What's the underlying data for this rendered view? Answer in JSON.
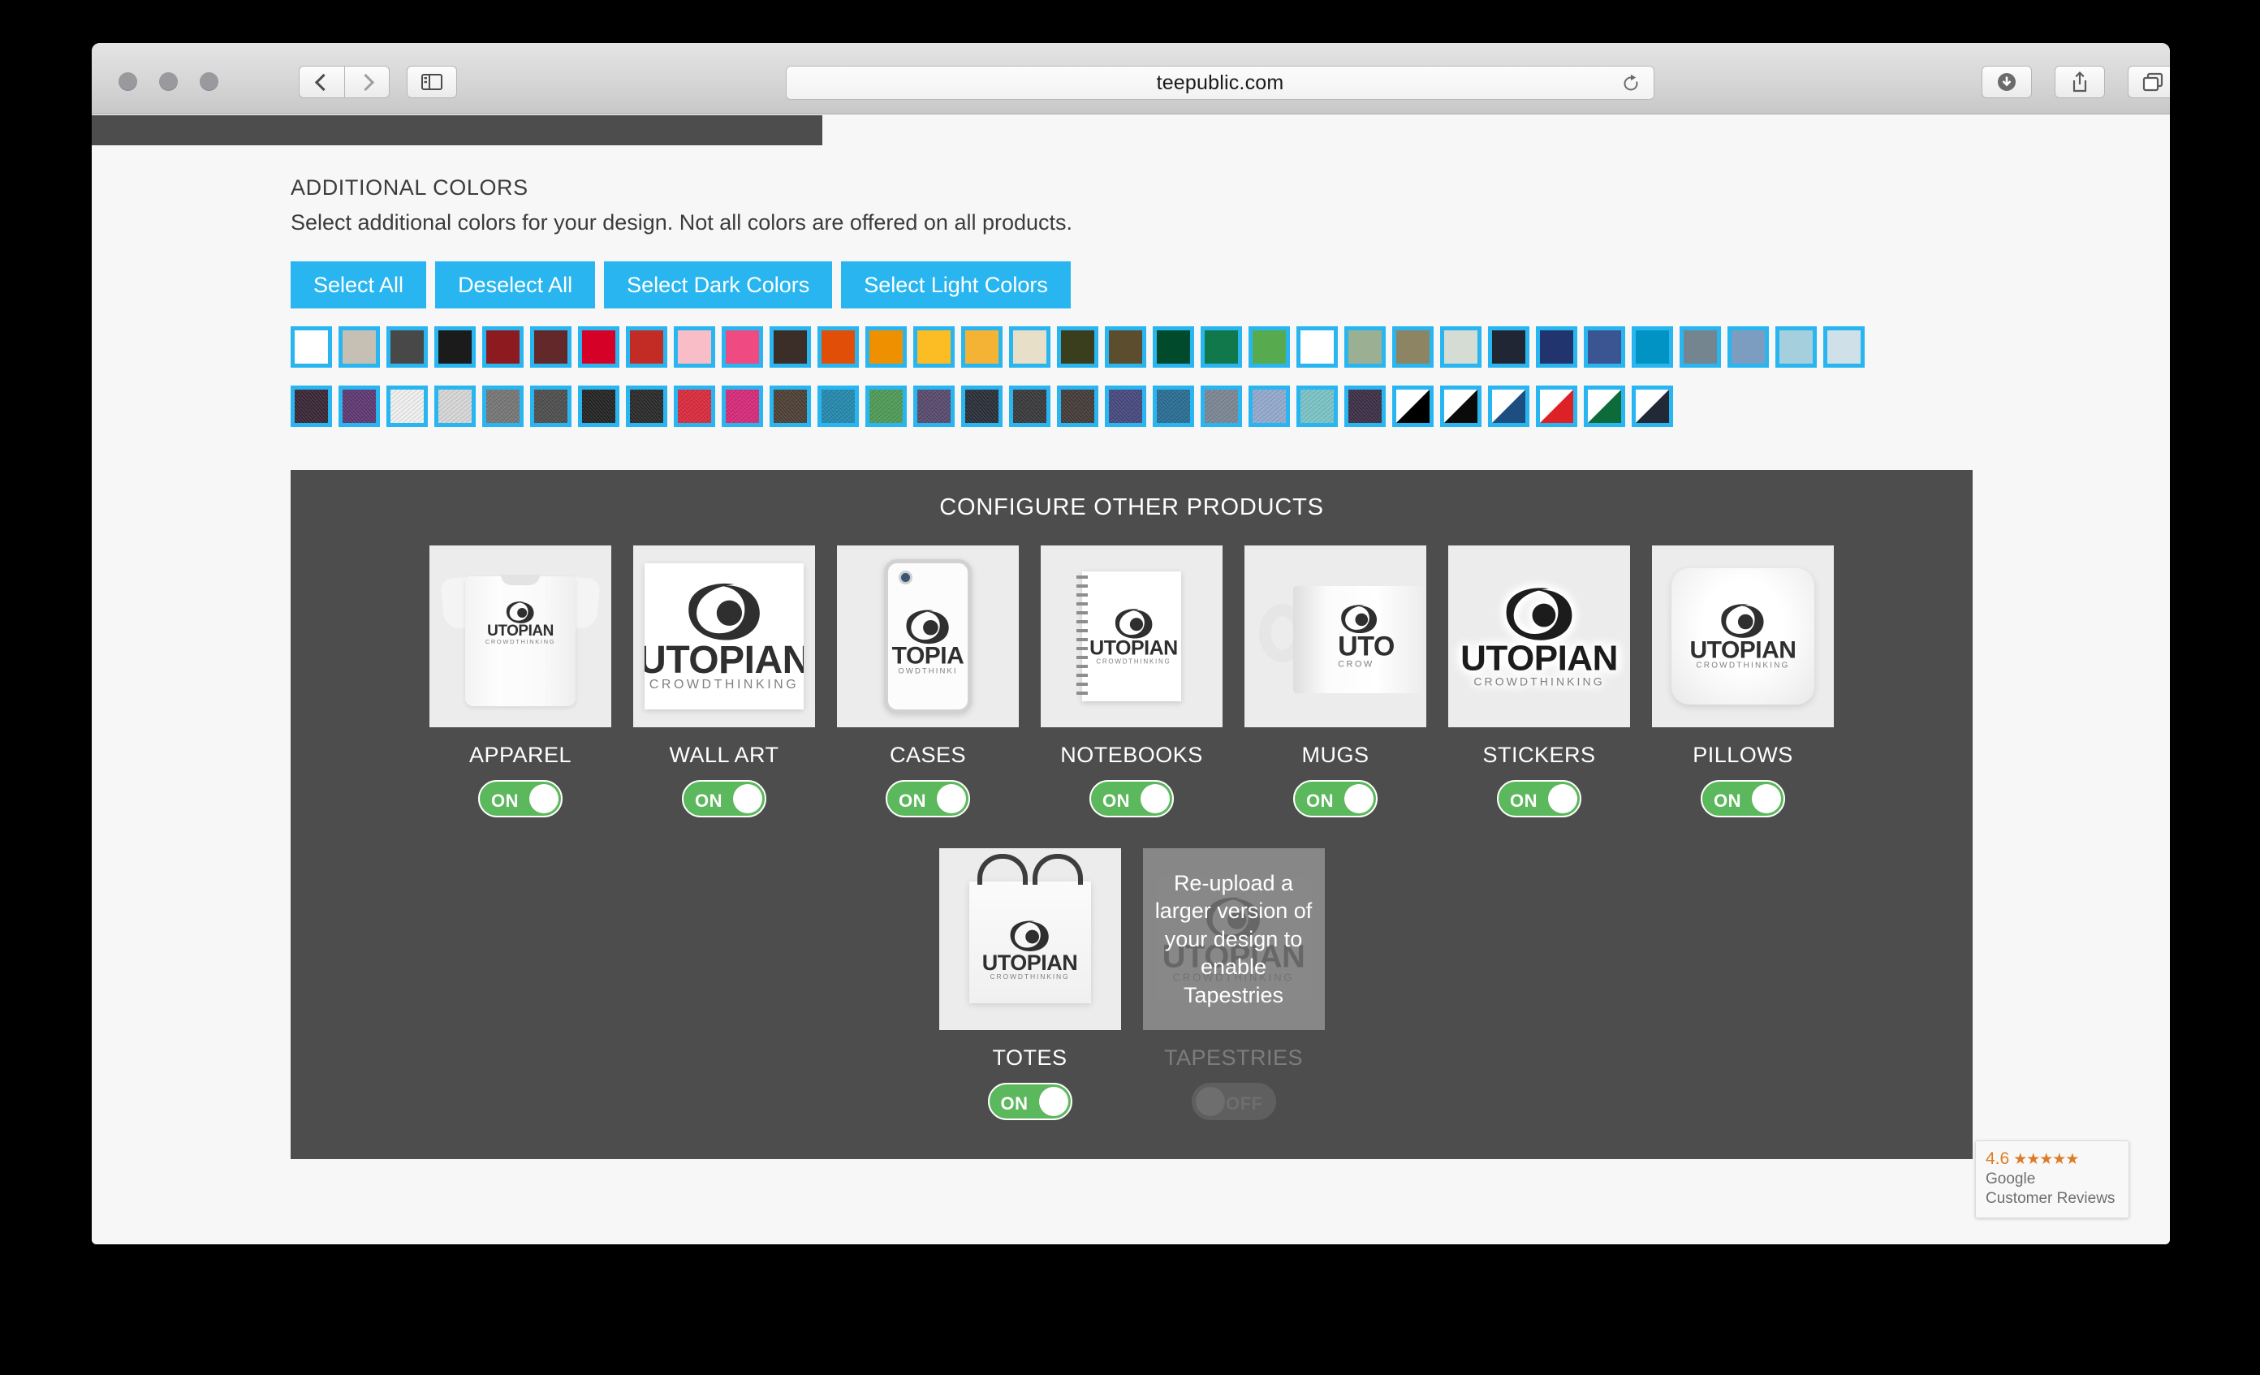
{
  "browser": {
    "url": "teepublic.com",
    "back_label": "Back",
    "forward_label": "Forward",
    "sidebar_label": "Show Sidebar",
    "reload_label": "Reload",
    "downloads_label": "Downloads",
    "share_label": "Share",
    "tabs_label": "Show Tab Overview",
    "new_tab_label": "+"
  },
  "colors_section": {
    "title": "ADDITIONAL COLORS",
    "subtitle": "Select additional colors for your design. Not all colors are offered on all products.",
    "buttons": [
      {
        "label": "Select All"
      },
      {
        "label": "Deselect All"
      },
      {
        "label": "Select Dark Colors"
      },
      {
        "label": "Select Light Colors"
      }
    ],
    "accent_color": "#29b6f0",
    "swatch_rows": [
      [
        {
          "name": "white",
          "hex": "#ffffff",
          "style": "solid"
        },
        {
          "name": "tan",
          "hex": "#c6c0b4",
          "style": "solid"
        },
        {
          "name": "dark-gray",
          "hex": "#484848",
          "style": "solid"
        },
        {
          "name": "black",
          "hex": "#1b1b1b",
          "style": "solid"
        },
        {
          "name": "dark-red",
          "hex": "#8c1a1f",
          "style": "solid"
        },
        {
          "name": "maroon",
          "hex": "#63282a",
          "style": "solid"
        },
        {
          "name": "red",
          "hex": "#d50127",
          "style": "solid"
        },
        {
          "name": "brick-red",
          "hex": "#c32c25",
          "style": "solid"
        },
        {
          "name": "light-pink",
          "hex": "#f8bdc6",
          "style": "solid"
        },
        {
          "name": "hot-pink",
          "hex": "#ef4a82",
          "style": "solid"
        },
        {
          "name": "dark-brown",
          "hex": "#3b2e28",
          "style": "solid"
        },
        {
          "name": "orange-red",
          "hex": "#e04e07",
          "style": "solid"
        },
        {
          "name": "orange",
          "hex": "#ef9000",
          "style": "solid"
        },
        {
          "name": "gold",
          "hex": "#fbbc24",
          "style": "solid"
        },
        {
          "name": "yellow-gold",
          "hex": "#f5b335",
          "style": "solid"
        },
        {
          "name": "cream",
          "hex": "#e8dfc8",
          "style": "solid"
        },
        {
          "name": "olive",
          "hex": "#3a3e1c",
          "style": "solid"
        },
        {
          "name": "brown",
          "hex": "#5c4d2e",
          "style": "solid"
        },
        {
          "name": "forest-green",
          "hex": "#014a2b",
          "style": "solid"
        },
        {
          "name": "green",
          "hex": "#10784a",
          "style": "solid"
        },
        {
          "name": "medium-green",
          "hex": "#57ab4e",
          "style": "solid"
        },
        {
          "name": "lime-green",
          "hex": "#93c council",
          "style": "solid"
        },
        {
          "name": "sage",
          "hex": "#9bb092",
          "style": "solid"
        },
        {
          "name": "khaki",
          "hex": "#8c8462",
          "style": "solid"
        },
        {
          "name": "pale-gray-green",
          "hex": "#d4dcd3",
          "style": "solid"
        },
        {
          "name": "navy-black",
          "hex": "#212634",
          "style": "solid"
        },
        {
          "name": "dark-blue",
          "hex": "#22346e",
          "style": "solid"
        },
        {
          "name": "royal-blue",
          "hex": "#3a5591",
          "style": "solid"
        },
        {
          "name": "cyan",
          "hex": "#0093c4",
          "style": "solid"
        },
        {
          "name": "slate-gray",
          "hex": "#74858f",
          "style": "solid"
        },
        {
          "name": "steel-blue",
          "hex": "#7c9dc0",
          "style": "solid"
        },
        {
          "name": "light-blue",
          "hex": "#a5cfdd",
          "style": "solid"
        },
        {
          "name": "pale-blue",
          "hex": "#cfe0e9",
          "style": "solid"
        }
      ],
      [
        {
          "name": "heather-plum",
          "hex": "#3a2736",
          "style": "heather"
        },
        {
          "name": "heather-purple",
          "hex": "#5f3872",
          "style": "heather"
        },
        {
          "name": "heather-white",
          "hex": "#efefef",
          "style": "heather"
        },
        {
          "name": "heather-light-gray",
          "hex": "#d6d6d6",
          "style": "heather"
        },
        {
          "name": "heather-gray",
          "hex": "#767676",
          "style": "heather"
        },
        {
          "name": "heather-charcoal",
          "hex": "#4e4e4e",
          "style": "heather"
        },
        {
          "name": "heather-black",
          "hex": "#242424",
          "style": "heather"
        },
        {
          "name": "heather-dark-black",
          "hex": "#2a2a2a",
          "style": "heather"
        },
        {
          "name": "heather-red",
          "hex": "#da2b3d",
          "style": "heather"
        },
        {
          "name": "heather-pink",
          "hex": "#d62a79",
          "style": "heather"
        },
        {
          "name": "heather-brown",
          "hex": "#4d4036",
          "style": "heather"
        },
        {
          "name": "heather-teal",
          "hex": "#2588ad",
          "style": "heather"
        },
        {
          "name": "heather-green",
          "hex": "#4f9a56",
          "style": "heather"
        },
        {
          "name": "heather-violet",
          "hex": "#584a6d",
          "style": "heather"
        },
        {
          "name": "heather-navy-dark",
          "hex": "#2a2f38",
          "style": "heather"
        },
        {
          "name": "heather-gray-dark",
          "hex": "#3a3a3c",
          "style": "heather"
        },
        {
          "name": "heather-coffee",
          "hex": "#443c39",
          "style": "heather"
        },
        {
          "name": "heather-indigo",
          "hex": "#47497e",
          "style": "heather"
        },
        {
          "name": "heather-blue",
          "hex": "#2a6d93",
          "style": "heather"
        },
        {
          "name": "heather-slate",
          "hex": "#7b8693",
          "style": "heather"
        },
        {
          "name": "heather-sky",
          "hex": "#93a9cd",
          "style": "heather"
        },
        {
          "name": "heather-aqua",
          "hex": "#7bc3c6",
          "style": "heather"
        },
        {
          "name": "heather-dark-purple",
          "hex": "#3d2f46",
          "style": "heather"
        },
        {
          "name": "black-white-raglan",
          "hex": "#000000",
          "style": "split"
        },
        {
          "name": "white-black-raglan",
          "hex": "#0a0a0a",
          "style": "split"
        },
        {
          "name": "blue-white-raglan",
          "hex": "#1d4e82",
          "style": "split"
        },
        {
          "name": "red-white-raglan",
          "hex": "#de2027",
          "style": "split"
        },
        {
          "name": "green-white-raglan",
          "hex": "#0d6b3a",
          "style": "split"
        },
        {
          "name": "navy-white-raglan",
          "hex": "#222836",
          "style": "split"
        }
      ]
    ]
  },
  "configure_panel": {
    "title": "CONFIGURE OTHER PRODUCTS",
    "products_row1": [
      {
        "label": "APPAREL",
        "toggle": "ON",
        "enabled": true,
        "art": "tee"
      },
      {
        "label": "WALL ART",
        "toggle": "ON",
        "enabled": true,
        "art": "wallart"
      },
      {
        "label": "CASES",
        "toggle": "ON",
        "enabled": true,
        "art": "case"
      },
      {
        "label": "NOTEBOOKS",
        "toggle": "ON",
        "enabled": true,
        "art": "notebook"
      },
      {
        "label": "MUGS",
        "toggle": "ON",
        "enabled": true,
        "art": "mug"
      },
      {
        "label": "STICKERS",
        "toggle": "ON",
        "enabled": true,
        "art": "sticker"
      },
      {
        "label": "PILLOWS",
        "toggle": "ON",
        "enabled": true,
        "art": "pillow"
      }
    ],
    "products_row2": [
      {
        "label": "TOTES",
        "toggle": "ON",
        "enabled": true,
        "art": "tote"
      },
      {
        "label": "TAPESTRIES",
        "toggle": "OFF",
        "enabled": false,
        "art": "tapestry",
        "overlay": "Re-upload a larger version of your design to enable Tapestries"
      }
    ],
    "toggle_on_color": "#5cb85c",
    "panel_color": "#4d4d4d"
  },
  "design": {
    "wordmark": "UTOPIAN",
    "tagline": "CROWDTHINKING",
    "case_wordmark": "TOPIA",
    "case_tagline": "OWDTHINKI",
    "mug_wordmark": "UTO",
    "mug_tagline": "CROW"
  },
  "google_reviews": {
    "score": "4.6",
    "stars": "★★★★★",
    "line1": "Google",
    "line2": "Customer Reviews",
    "accent": "#dd7b26"
  }
}
